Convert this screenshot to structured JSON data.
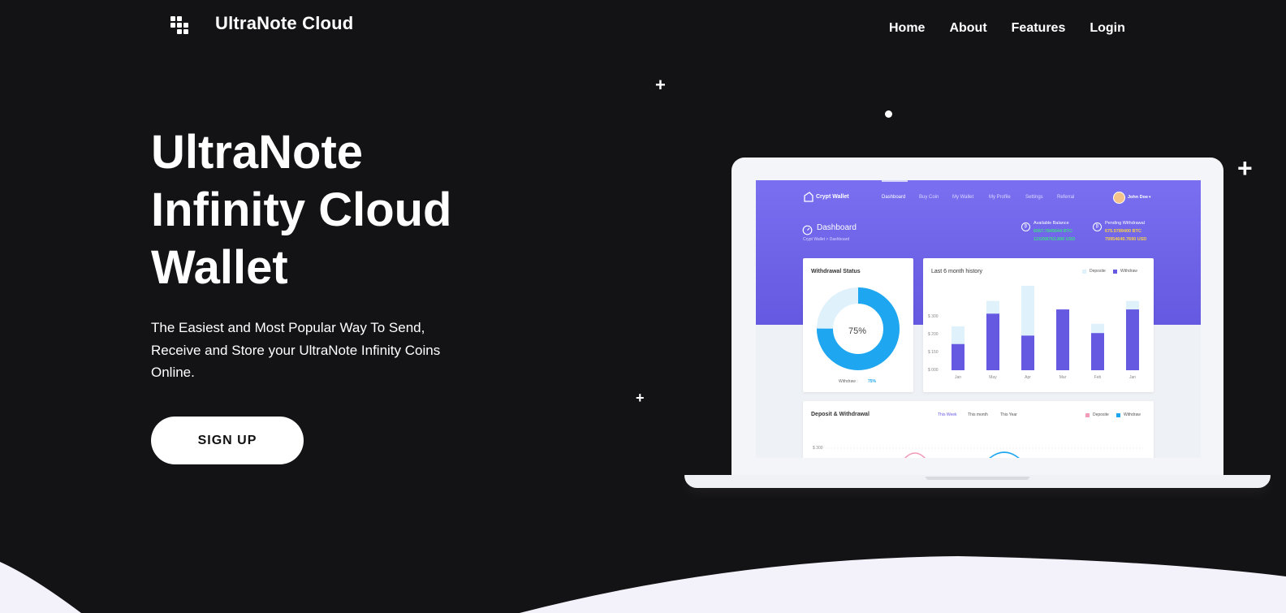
{
  "header": {
    "brand": "UltraNote Cloud",
    "nav": [
      "Home",
      "About",
      "Features",
      "Login"
    ]
  },
  "hero": {
    "title": "UltraNote Infinity Cloud Wallet",
    "subtitle": "The Easiest and Most Popular Way To Send, Receive and Store your UltraNote Infinity Coins Online.",
    "cta": "SIGN UP"
  },
  "mockup": {
    "app_name": "Crypt Wallet",
    "menu": [
      "Dashboard",
      "Buy Coin",
      "My Wallet",
      "My Profile",
      "Settings",
      "Referral"
    ],
    "user": "John Doe",
    "page_title": "Dashboard",
    "breadcrumb": "Crypt Wallet  >  Dashboard",
    "available_balance_label": "Available Balance",
    "available_btc": "6067.7845644 BTC",
    "available_usd": "121058762.890 USD",
    "pending_label": "Pending Withdrawal",
    "pending_btc": "675.5789400 BTC",
    "pending_usd": "79954640.7690 USD",
    "withdrawal_status_title": "Withdrawal Status",
    "donut_percent": "75%",
    "donut_value": 0.75,
    "withdraw_label": "Withdraw :",
    "withdraw_value": "75%",
    "history_title": "Last 6 month history",
    "legend_deposit": "Deposite",
    "legend_withdraw": "Withdraw",
    "y_ticks": [
      "$ 300",
      "$ 200",
      "$ 150",
      "$ 000"
    ],
    "months": [
      "Jan",
      "May",
      "Apr",
      "Mar",
      "Feb",
      "Jan"
    ],
    "bar_deposit": [
      0.52,
      0.82,
      1.0,
      0.72,
      0.55,
      0.82
    ],
    "bar_withdraw": [
      0.31,
      0.67,
      0.41,
      0.72,
      0.44,
      0.72
    ],
    "dw_title": "Deposit & Withdrawal",
    "dw_tabs": [
      "This Week",
      "This month",
      "This Year"
    ],
    "dw_legend_deposit": "Deposite",
    "dw_legend_withdraw": "Withdraw",
    "dw_tick": "$ 300"
  },
  "colors": {
    "background": "#131214",
    "accent_purple": "#6459e0",
    "accent_blue": "#1ea7f0",
    "light_blue": "#dff1fb",
    "green": "#3ddc84",
    "yellow": "#f7d046"
  }
}
